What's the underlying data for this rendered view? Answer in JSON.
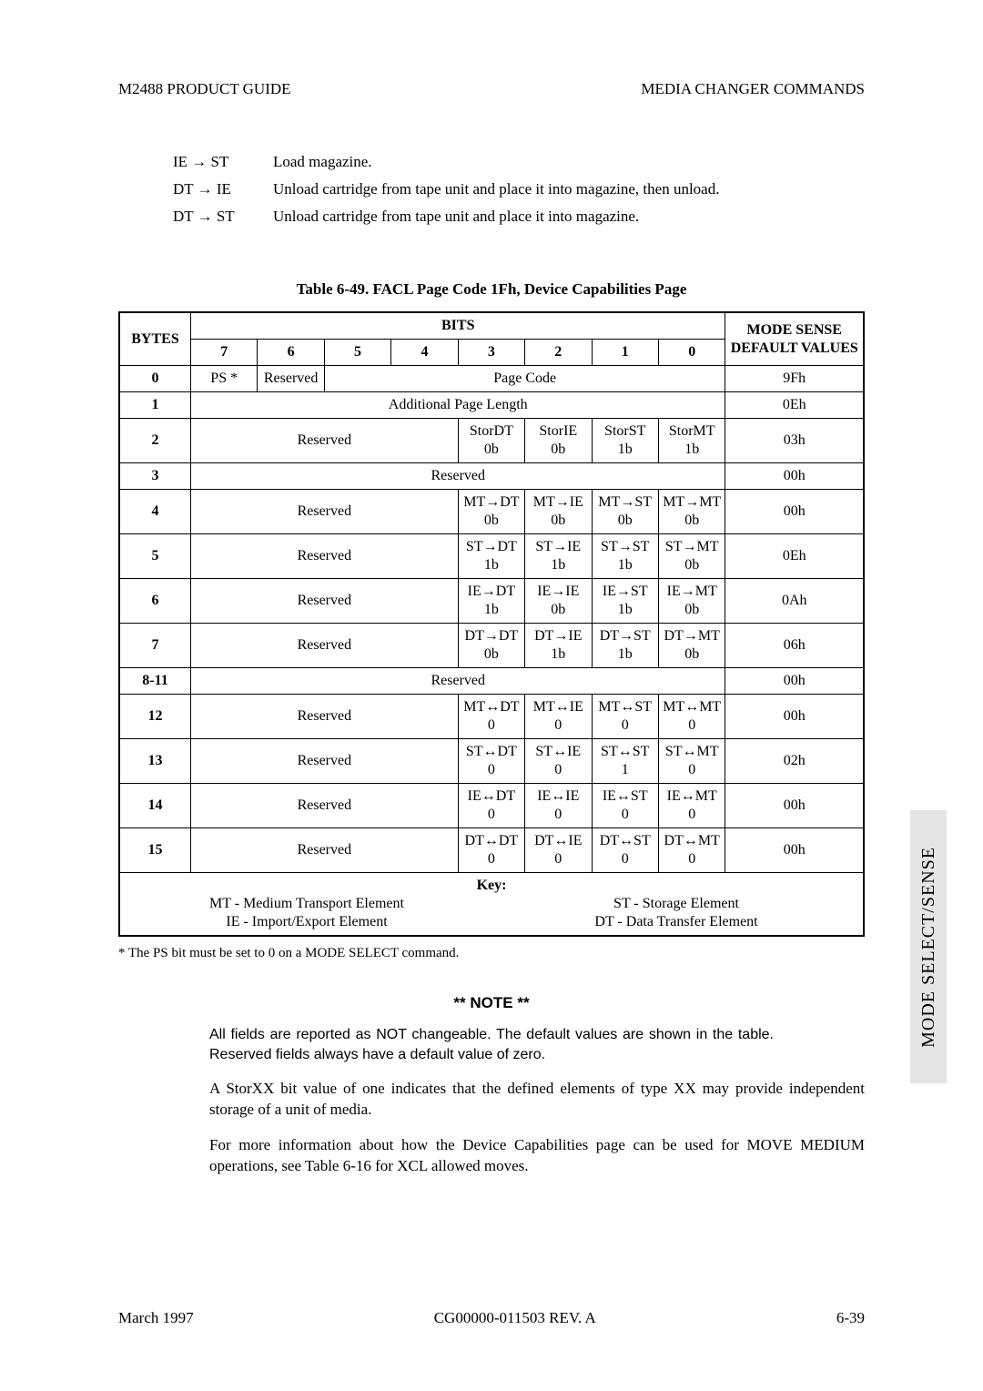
{
  "header": {
    "left": "M2488 PRODUCT GUIDE",
    "right": "MEDIA CHANGER COMMANDS"
  },
  "side_tab": "MODE SELECT/SENSE",
  "defs": [
    {
      "term": "IE → ST",
      "desc": "Load magazine."
    },
    {
      "term": "DT → IE",
      "desc": "Unload cartridge from tape unit and place it into magazine, then unload."
    },
    {
      "term": "DT → ST",
      "desc": "Unload cartridge from tape unit and place it into magazine."
    }
  ],
  "caption": "Table 6-49.  FACL Page Code 1Fh, Device Capabilities Page",
  "tbl": {
    "bits_label": "BITS",
    "mode_sense_label": "MODE SENSE DEFAULT VALUES",
    "bytes_label": "BYTES",
    "bits": [
      "7",
      "6",
      "5",
      "4",
      "3",
      "2",
      "1",
      "0"
    ],
    "rows": {
      "r0": {
        "byte": "0",
        "ps": "PS *",
        "res": "Reserved",
        "pc": "Page Code",
        "def": "9Fh"
      },
      "r1": {
        "byte": "1",
        "apl": "Additional Page Length",
        "def": "0Eh"
      },
      "r2": {
        "byte": "2",
        "res": "Reserved",
        "c3a": "StorDT",
        "c3b": "0b",
        "c2a": "StorIE",
        "c2b": "0b",
        "c1a": "StorST",
        "c1b": "1b",
        "c0a": "StorMT",
        "c0b": "1b",
        "def": "03h"
      },
      "r3": {
        "byte": "3",
        "res": "Reserved",
        "def": "00h"
      },
      "r4": {
        "byte": "4",
        "res": "Reserved",
        "c3a": "MT→DT",
        "c3b": "0b",
        "c2a": "MT→IE",
        "c2b": "0b",
        "c1a": "MT→ST",
        "c1b": "0b",
        "c0a": "MT→MT",
        "c0b": "0b",
        "def": "00h"
      },
      "r5": {
        "byte": "5",
        "res": "Reserved",
        "c3a": "ST→DT",
        "c3b": "1b",
        "c2a": "ST→IE",
        "c2b": "1b",
        "c1a": "ST→ST",
        "c1b": "1b",
        "c0a": "ST→MT",
        "c0b": "0b",
        "def": "0Eh"
      },
      "r6": {
        "byte": "6",
        "res": "Reserved",
        "c3a": "IE→DT",
        "c3b": "1b",
        "c2a": "IE→IE",
        "c2b": "0b",
        "c1a": "IE→ST",
        "c1b": "1b",
        "c0a": "IE→MT",
        "c0b": "0b",
        "def": "0Ah"
      },
      "r7": {
        "byte": "7",
        "res": "Reserved",
        "c3a": "DT→DT",
        "c3b": "0b",
        "c2a": "DT→IE",
        "c2b": "1b",
        "c1a": "DT→ST",
        "c1b": "1b",
        "c0a": "DT→MT",
        "c0b": "0b",
        "def": "06h"
      },
      "r8": {
        "byte": "8-11",
        "res": "Reserved",
        "def": "00h"
      },
      "r12": {
        "byte": "12",
        "res": "Reserved",
        "c3a": "MT↔DT",
        "c3b": "0",
        "c2a": "MT↔IE",
        "c2b": "0",
        "c1a": "MT↔ST",
        "c1b": "0",
        "c0a": "MT↔MT",
        "c0b": "0",
        "def": "00h"
      },
      "r13": {
        "byte": "13",
        "res": "Reserved",
        "c3a": "ST↔DT",
        "c3b": "0",
        "c2a": "ST↔IE",
        "c2b": "0",
        "c1a": "ST↔ST",
        "c1b": "1",
        "c0a": "ST↔MT",
        "c0b": "0",
        "def": "02h"
      },
      "r14": {
        "byte": "14",
        "res": "Reserved",
        "c3a": "IE↔DT",
        "c3b": "0",
        "c2a": "IE↔IE",
        "c2b": "0",
        "c1a": "IE↔ST",
        "c1b": "0",
        "c0a": "IE↔MT",
        "c0b": "0",
        "def": "00h"
      },
      "r15": {
        "byte": "15",
        "res": "Reserved",
        "c3a": "DT↔DT",
        "c3b": "0",
        "c2a": "DT↔IE",
        "c2b": "0",
        "c1a": "DT↔ST",
        "c1b": "0",
        "c0a": "DT↔MT",
        "c0b": "0",
        "def": "00h"
      }
    },
    "key_label": "Key:",
    "key_mt": "MT - Medium Transport Element",
    "key_ie": "IE  - Import/Export Element",
    "key_st": "ST - Storage Element",
    "key_dt": "DT - Data Transfer Element"
  },
  "footnote": "* The PS bit must be set to 0 on a MODE SELECT command.",
  "note_head": "** NOTE **",
  "note_body": "All fields are reported as NOT changeable. The default values are shown in the table. Reserved fields always have a default value of zero.",
  "para1": "A StorXX bit value of one indicates that the defined elements of type XX may provide independent storage of a unit of media.",
  "para2": "For more information about how the Device Capabilities page can be used for MOVE MEDIUM operations, see Table 6-16 for XCL allowed moves.",
  "footer": {
    "left": "March 1997",
    "center": "CG00000-011503 REV. A",
    "right": "6-39"
  }
}
